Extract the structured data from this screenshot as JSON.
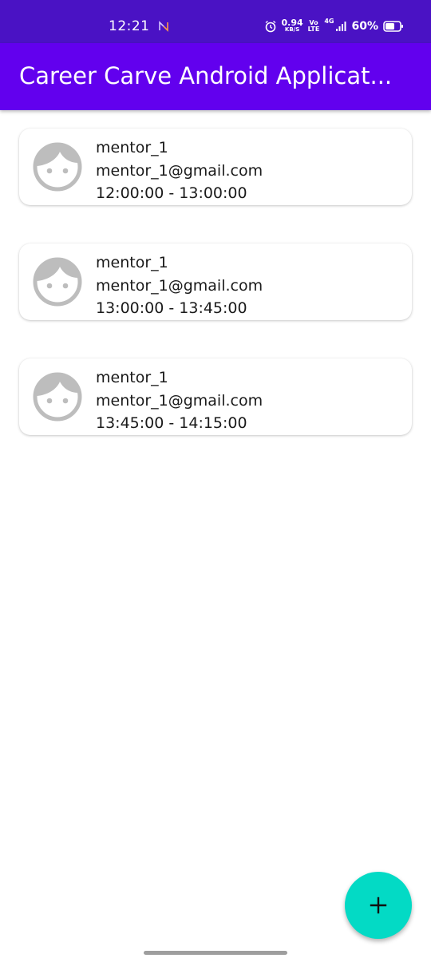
{
  "status_bar": {
    "time": "12:21",
    "network_speed": "0.94",
    "network_speed_unit": "KB/S",
    "volte_top": "Vo",
    "volte_bottom": "LTE",
    "network_type": "4G",
    "battery_percent": "60%",
    "icons": [
      "nfc-icon",
      "alarm-icon",
      "signal-icon",
      "battery-icon"
    ]
  },
  "app_bar": {
    "title": "Career Carve Android Applicat..."
  },
  "mentors": [
    {
      "name": "mentor_1",
      "email": "mentor_1@gmail.com",
      "time_slot": "12:00:00 - 13:00:00",
      "avatar_icon": "face-icon"
    },
    {
      "name": "mentor_1",
      "email": "mentor_1@gmail.com",
      "time_slot": "13:00:00 - 13:45:00",
      "avatar_icon": "face-icon"
    },
    {
      "name": "mentor_1",
      "email": "mentor_1@gmail.com",
      "time_slot": "13:45:00 - 14:15:00",
      "avatar_icon": "face-icon"
    }
  ],
  "fab": {
    "icon": "plus-icon"
  },
  "colors": {
    "status_bar": "#4a12c4",
    "app_bar": "#6200ee",
    "fab": "#03dac5",
    "avatar": "#bdbdbd",
    "text": "#1a1a1a"
  }
}
